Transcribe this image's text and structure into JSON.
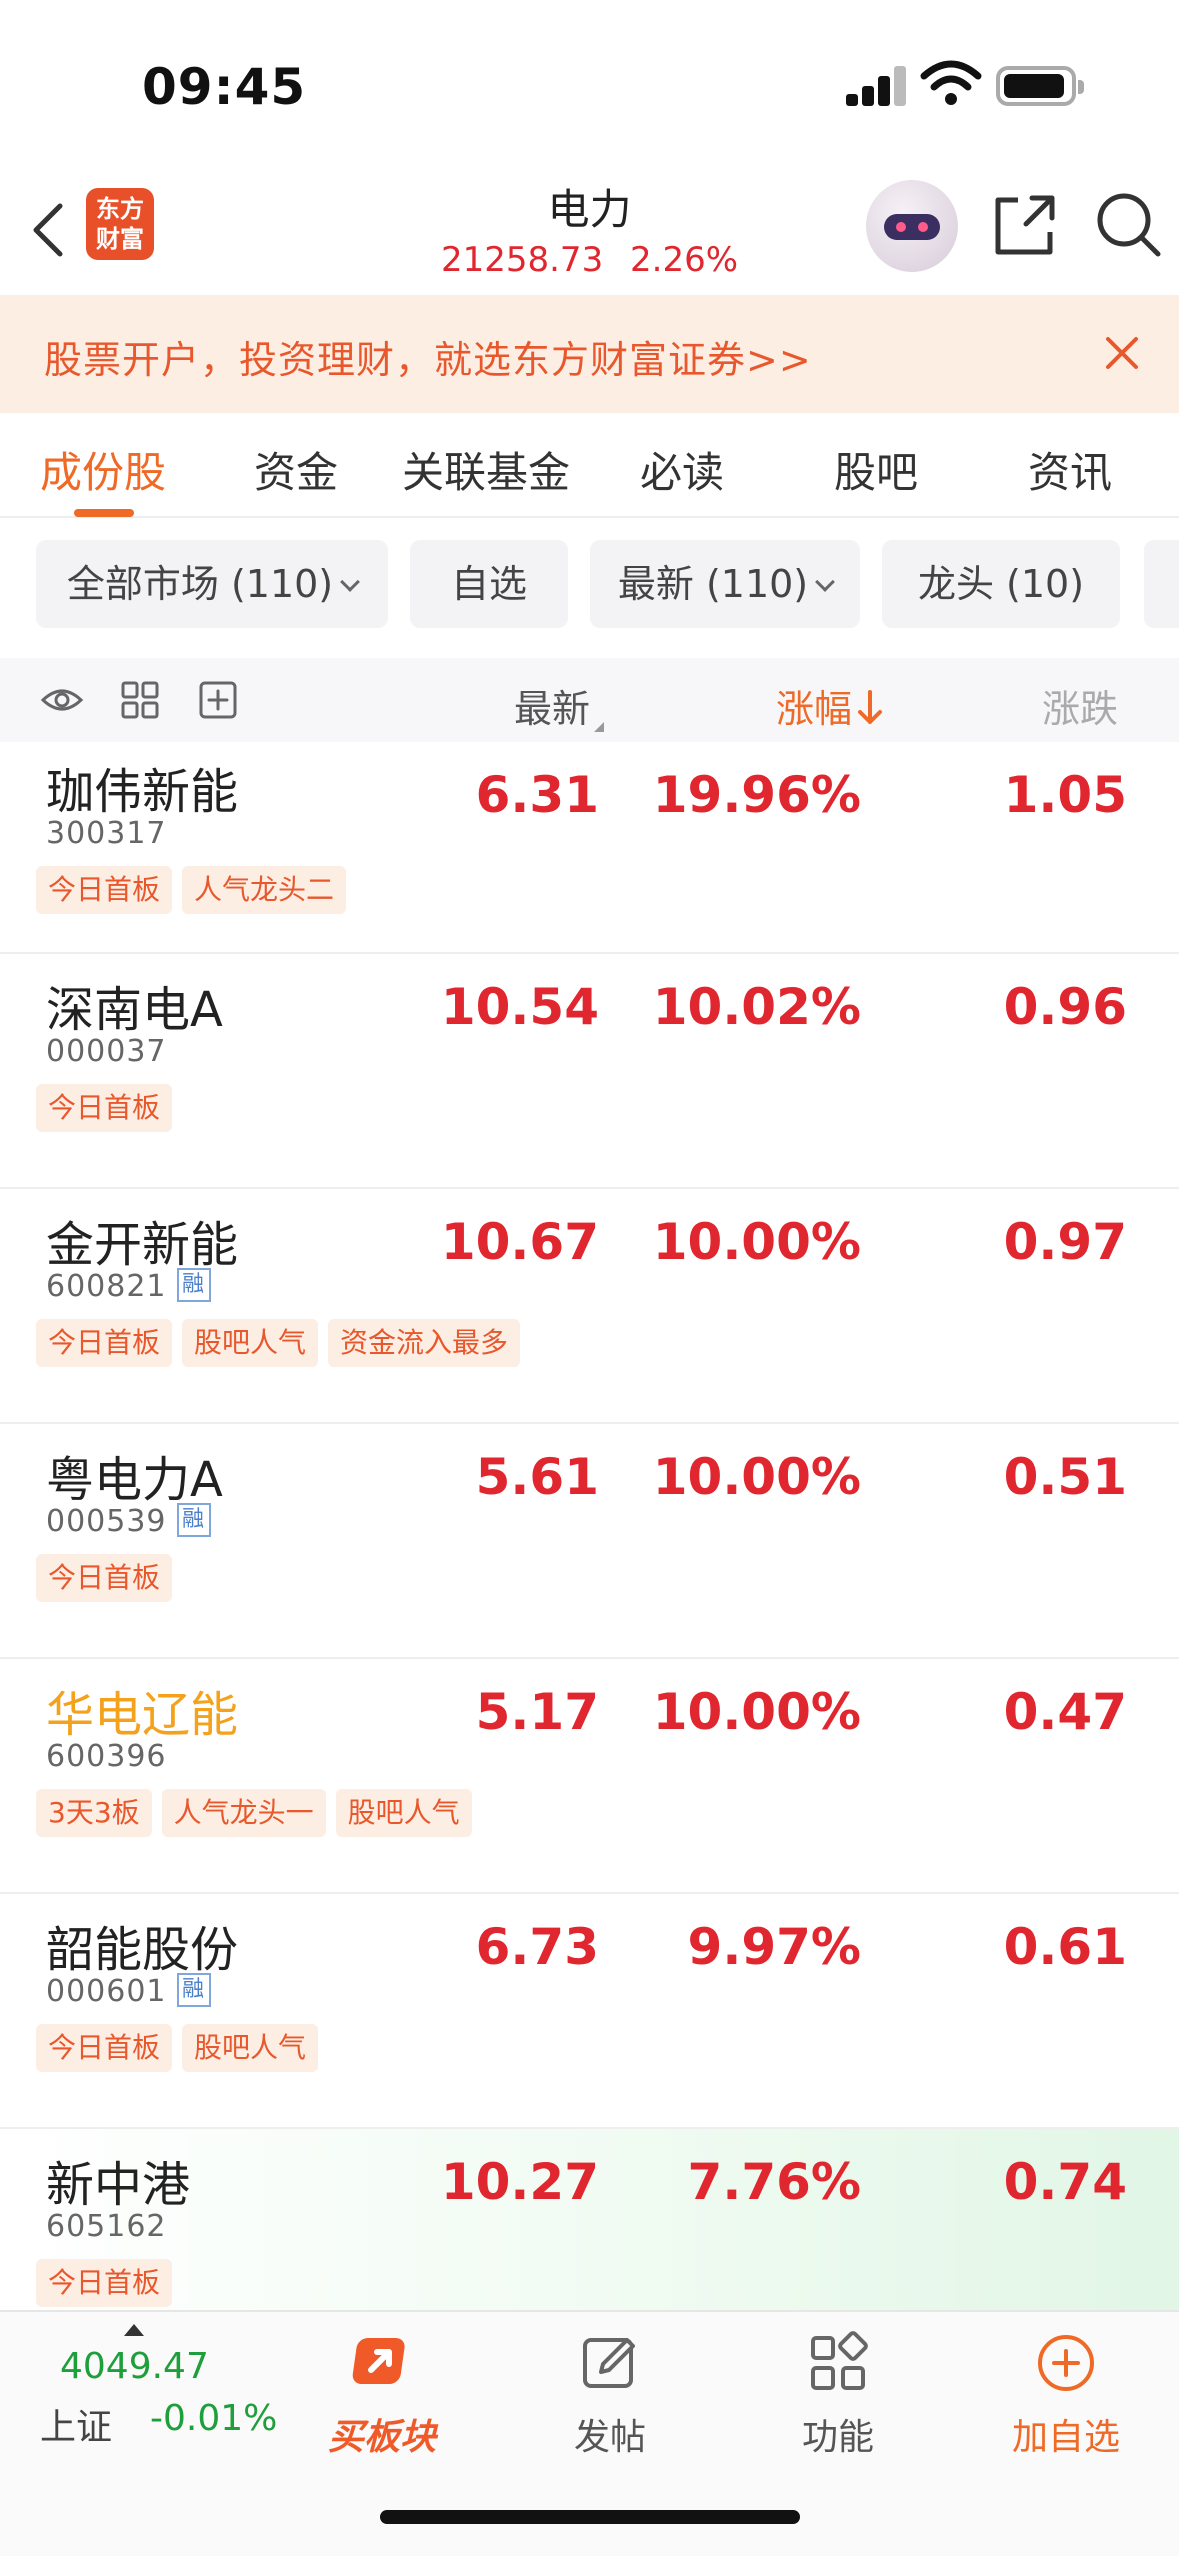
{
  "status_bar": {
    "time": "09:45"
  },
  "header": {
    "logo_text": "东方财富",
    "title": "电力",
    "index_value": "21258.73",
    "index_change": "2.26%"
  },
  "banner": {
    "text": "股票开户，投资理财，就选东方财富证券>>"
  },
  "tabs": [
    {
      "label": "成份股",
      "active": true
    },
    {
      "label": "资金"
    },
    {
      "label": "关联基金"
    },
    {
      "label": "必读"
    },
    {
      "label": "股吧"
    },
    {
      "label": "资讯"
    }
  ],
  "filters": [
    {
      "label": "全部市场 (110)",
      "dropdown": true
    },
    {
      "label": "自选"
    },
    {
      "label": "最新 (110)",
      "dropdown": true
    },
    {
      "label": "龙头 (10)"
    }
  ],
  "columns": {
    "price": "最新",
    "pct": "涨幅",
    "chg": "涨跌"
  },
  "rows": [
    {
      "name": "珈伟新能",
      "code": "300317",
      "rong": false,
      "price": "6.31",
      "pct": "19.96%",
      "chg": "1.05",
      "tags": [
        "今日首板",
        "人气龙头二"
      ]
    },
    {
      "name": "深南电A",
      "code": "000037",
      "rong": false,
      "price": "10.54",
      "pct": "10.02%",
      "chg": "0.96",
      "tags": [
        "今日首板"
      ]
    },
    {
      "name": "金开新能",
      "code": "600821",
      "rong": true,
      "price": "10.67",
      "pct": "10.00%",
      "chg": "0.97",
      "tags": [
        "今日首板",
        "股吧人气",
        "资金流入最多"
      ]
    },
    {
      "name": "粤电力A",
      "code": "000539",
      "rong": true,
      "price": "5.61",
      "pct": "10.00%",
      "chg": "0.51",
      "tags": [
        "今日首板"
      ]
    },
    {
      "name": "华电辽能",
      "code": "600396",
      "rong": false,
      "hot": true,
      "price": "5.17",
      "pct": "10.00%",
      "chg": "0.47",
      "tags": [
        "3天3板",
        "人气龙头一",
        "股吧人气"
      ]
    },
    {
      "name": "韶能股份",
      "code": "000601",
      "rong": true,
      "price": "6.73",
      "pct": "9.97%",
      "chg": "0.61",
      "tags": [
        "今日首板",
        "股吧人气"
      ]
    },
    {
      "name": "新中港",
      "code": "605162",
      "rong": false,
      "price": "10.27",
      "pct": "7.76%",
      "chg": "0.74",
      "tags": [
        "今日首板"
      ]
    }
  ],
  "rong_label": "融",
  "bottom_bar": {
    "index_value": "4049.47",
    "index_name": "上证",
    "index_change": "-0.01%",
    "nav": [
      {
        "label": "买板块",
        "icon": "buy-sector-icon"
      },
      {
        "label": "发帖",
        "icon": "compose-icon"
      },
      {
        "label": "功能",
        "icon": "grid-icon"
      },
      {
        "label": "加自选",
        "icon": "add-circle-icon"
      }
    ]
  },
  "colors": {
    "up": "#e0262e",
    "accent": "#ef6a26",
    "down": "#1f9e3c",
    "hot_name": "#f4a11c"
  }
}
